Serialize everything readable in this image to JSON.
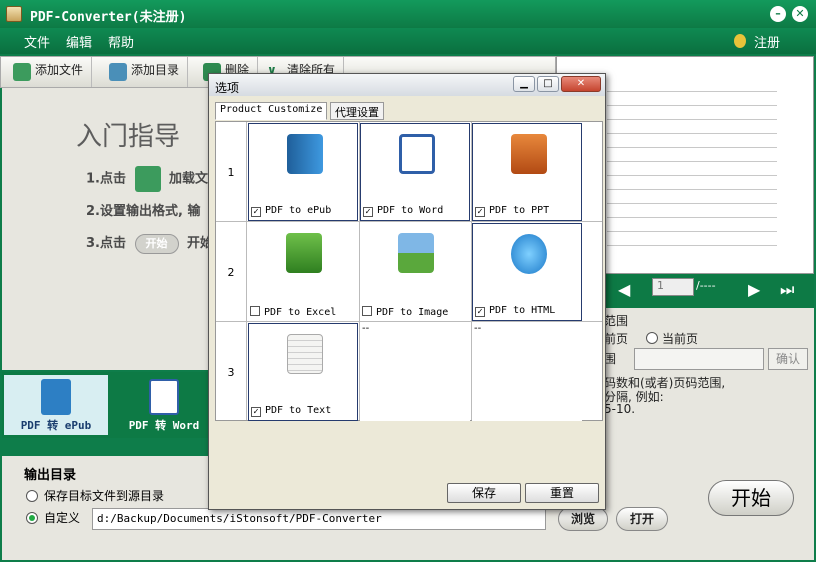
{
  "app": {
    "title": "PDF-Converter(未注册)"
  },
  "menu": {
    "file": "文件",
    "edit": "编辑",
    "help": "帮助",
    "register": "注册"
  },
  "toolbar": {
    "add_file": "添加文件",
    "add_dir": "添加目录",
    "delete": "删除",
    "clear_all": "清除所有"
  },
  "guide": {
    "heading": "入门指导",
    "step1_prefix": "1.点击",
    "step1_suffix": "加载文",
    "step2": "2.设置输出格式, 输",
    "step3_prefix": "3.点击",
    "step3_button": "开始",
    "step3_suffix": "开始"
  },
  "nav": {
    "page_value": "1",
    "page_total": "/----"
  },
  "range": {
    "title": "范围",
    "all_pages": "前页",
    "current_page": "当前页",
    "custom": "围",
    "confirm": "确认",
    "hint1": "码数和(或者)页码范围,",
    "hint2": "分隔, 例如:",
    "hint3": "5-10."
  },
  "thumbs": [
    {
      "label": "PDF 转 ePub"
    },
    {
      "label": "PDF 转 Word"
    }
  ],
  "output": {
    "title": "输出目录",
    "opt_source": "保存目标文件到源目录",
    "opt_custom": "自定义",
    "path": "d:/Backup/Documents/iStonsoft/PDF-Converter",
    "browse": "浏览",
    "open": "打开",
    "start": "开始"
  },
  "dialog": {
    "title": "选项",
    "tabs": [
      "Product Customize",
      "代理设置"
    ],
    "row_labels": [
      "1",
      "2",
      "3"
    ],
    "cells": [
      {
        "label": "PDF to ePub",
        "checked": true
      },
      {
        "label": "PDF to Word",
        "checked": true
      },
      {
        "label": "PDF to PPT",
        "checked": true
      },
      {
        "label": "PDF to Excel",
        "checked": false
      },
      {
        "label": "PDF to Image",
        "checked": false
      },
      {
        "label": "PDF to HTML",
        "checked": true
      },
      {
        "label": "PDF to Text",
        "checked": true
      }
    ],
    "empty_mark": "--",
    "save": "保存",
    "reset": "重置"
  }
}
